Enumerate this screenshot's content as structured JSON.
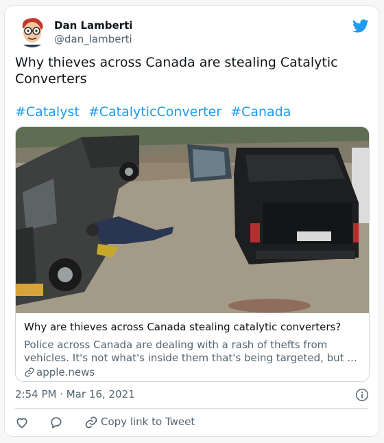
{
  "author": {
    "name": "Dan Lamberti",
    "handle": "@dan_lamberti"
  },
  "tweet": {
    "text": "Why thieves across Canada are stealing Catalytic Converters",
    "hashtags": [
      "#Catalyst",
      "#CatalyticConverter",
      "#Canada"
    ]
  },
  "link_card": {
    "title": "Why are thieves across Canada stealing catalytic converters?",
    "description": "Police across Canada are dealing with a rash of thefts from vehicles. It's not what's inside them that's being targeted, but ...",
    "domain": "apple.news"
  },
  "timestamp": "2:54 PM · Mar 16, 2021",
  "actions": {
    "copy_link_label": "Copy link to Tweet"
  },
  "icons": [
    "twitter-bird-icon",
    "info-icon",
    "heart-icon",
    "reply-icon",
    "link-icon"
  ],
  "colors": {
    "accent": "#1d9bf0",
    "secondary_text": "#536471",
    "primary_text": "#0f1419"
  }
}
